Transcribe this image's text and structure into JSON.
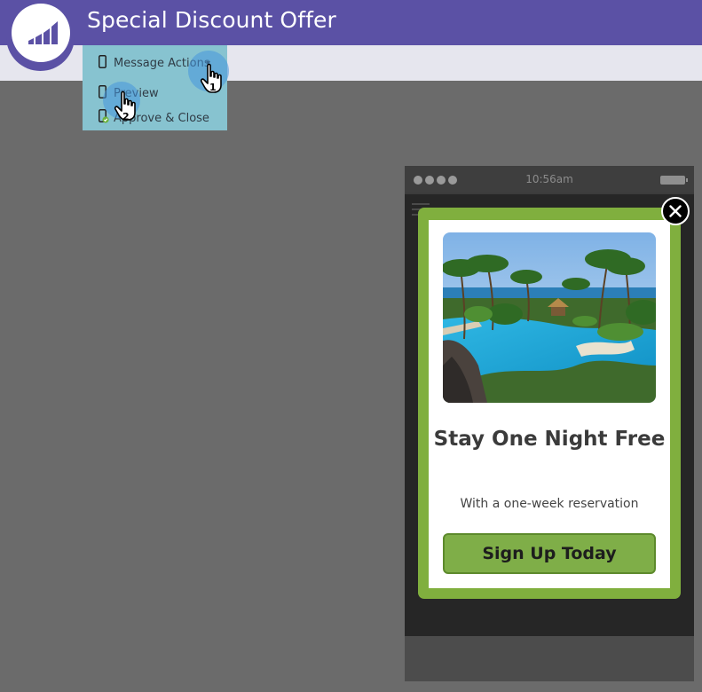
{
  "header": {
    "title": "Special Discount Offer"
  },
  "logo": {
    "icon": "marketo-bars-icon"
  },
  "menu": {
    "items": [
      {
        "label": "Message Actions",
        "icon": "mobile-icon"
      },
      {
        "label": "Preview",
        "icon": "mobile-icon"
      },
      {
        "label": "Approve & Close",
        "icon": "mobile-approve-icon"
      }
    ],
    "dropdown_glyph": "▾"
  },
  "steps": {
    "one": "1",
    "two": "2"
  },
  "phone": {
    "time": "10:56am"
  },
  "modal": {
    "title": "Stay One Night Free",
    "subtitle": "With a one-week reservation",
    "cta_label": "Sign Up Today",
    "close_icon": "close-x-icon"
  },
  "colors": {
    "header": "#5b51a5",
    "menu": "#87c3d0",
    "modal_border": "#80af3e",
    "cta": "#7fae48",
    "canvas": "#6b6b6b"
  }
}
